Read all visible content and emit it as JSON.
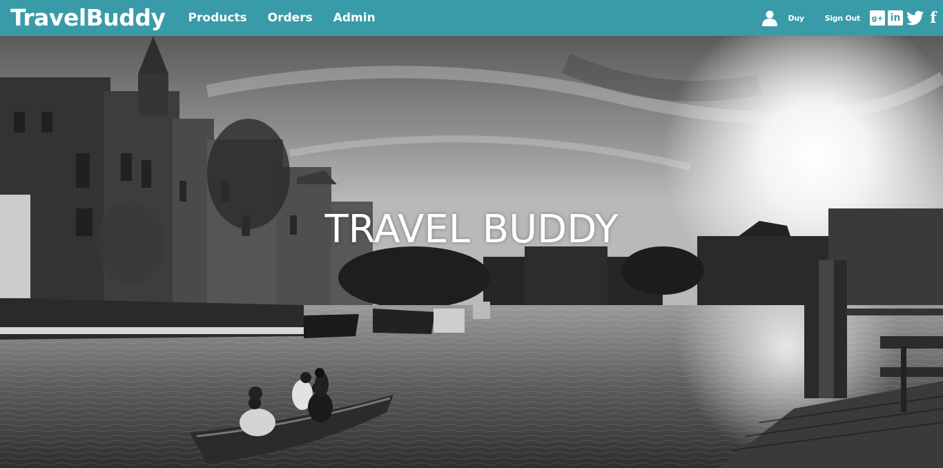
{
  "navbar": {
    "brand": "TravelBuddy",
    "links": [
      {
        "label": "Products"
      },
      {
        "label": "Orders"
      },
      {
        "label": "Admin"
      }
    ],
    "user": {
      "icon": "user-icon",
      "name": "Duy"
    },
    "signout_label": "Sign Out",
    "social": [
      {
        "icon": "google-plus-icon",
        "glyph": "g+"
      },
      {
        "icon": "linkedin-icon",
        "glyph": "in"
      },
      {
        "icon": "twitter-icon"
      },
      {
        "icon": "facebook-icon",
        "glyph": "f"
      }
    ]
  },
  "hero": {
    "title": "TRAVEL BUDDY",
    "image": "black-and-white canal cityscape"
  },
  "colors": {
    "navbar_bg": "#3a9ba8",
    "text": "#ffffff"
  }
}
